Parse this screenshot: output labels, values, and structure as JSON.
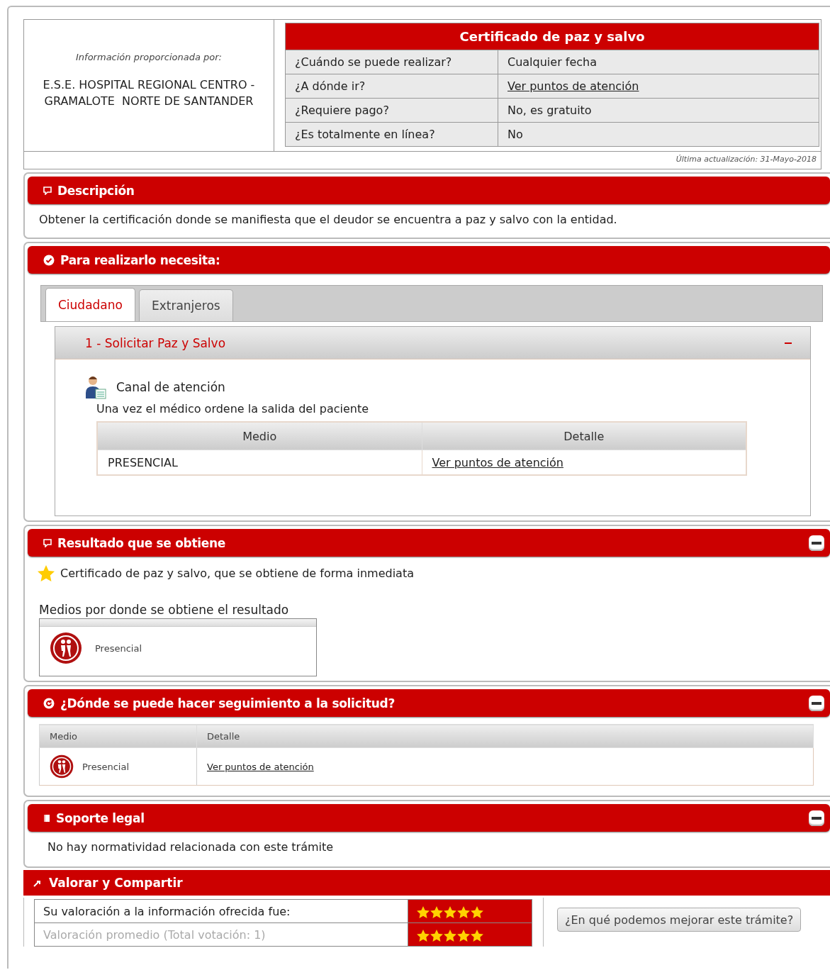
{
  "provider": {
    "label": "Información proporcionada por:",
    "name": "E.S.E. HOSPITAL REGIONAL CENTRO - GRAMALOTE  NORTE DE SANTANDER"
  },
  "summary": {
    "title": "Certificado de paz y salvo",
    "rows": [
      {
        "question": "¿Cuándo se puede realizar?",
        "answer": "Cualquier fecha",
        "kind": "text"
      },
      {
        "question": "¿A dónde ir?",
        "answer": "Ver puntos de atención",
        "kind": "link"
      },
      {
        "question": "¿Requiere pago?",
        "answer": "No, es gratuito",
        "kind": "text"
      },
      {
        "question": "¿Es totalmente en línea?",
        "answer": "No",
        "kind": "text"
      }
    ]
  },
  "last_update": "Última actualización: 31-Mayo-2018",
  "sections": [
    {
      "kind": "description",
      "title": "Descripción",
      "collapse_icon": false,
      "text": "Obtener la certificación donde se manifiesta que el deudor se encuentra a paz y salvo con la entidad."
    },
    {
      "kind": "requirements",
      "title": "Para realizarlo necesita:",
      "collapse_icon": false,
      "tabs": [
        {
          "label": "Ciudadano",
          "selected": true
        },
        {
          "label": "Extranjeros",
          "selected": false
        }
      ],
      "step": {
        "title": "1 - Solicitar Paz y Salvo",
        "expanded": true,
        "channel_title": "Canal de atención",
        "note": "Una vez el médico ordene la salida del paciente",
        "columns": [
          "Medio",
          "Detalle"
        ],
        "rows": [
          {
            "medio": "PRESENCIAL",
            "detalle": "Ver puntos de atención"
          }
        ]
      }
    },
    {
      "kind": "result",
      "title": "Resultado que se obtiene",
      "collapse_icon": true,
      "result": "Certificado de paz y salvo, que se obtiene de forma inmediata",
      "media_title": "Medios por donde se obtiene el resultado",
      "media": [
        "Presencial"
      ]
    },
    {
      "kind": "tracking",
      "title": "¿Dónde se puede hacer seguimiento a la solicitud?",
      "collapse_icon": true,
      "columns": [
        "Medio",
        "Detalle"
      ],
      "rows": [
        {
          "medio": "Presencial",
          "detalle": "Ver puntos de atención"
        }
      ]
    },
    {
      "kind": "legal",
      "title": "Soporte legal",
      "collapse_icon": true,
      "text": "No hay normatividad relacionada con este trámite"
    }
  ],
  "rating": {
    "title": "Valorar y Compartir",
    "rows": [
      {
        "label": "Su valoración a la información ofrecida fue:",
        "stars": 5,
        "dimmed": false
      },
      {
        "label": "Valoración promedio (Total votación: 1)",
        "stars": 5,
        "dimmed": true
      }
    ],
    "button": "¿En qué podemos mejorar este trámite?"
  }
}
